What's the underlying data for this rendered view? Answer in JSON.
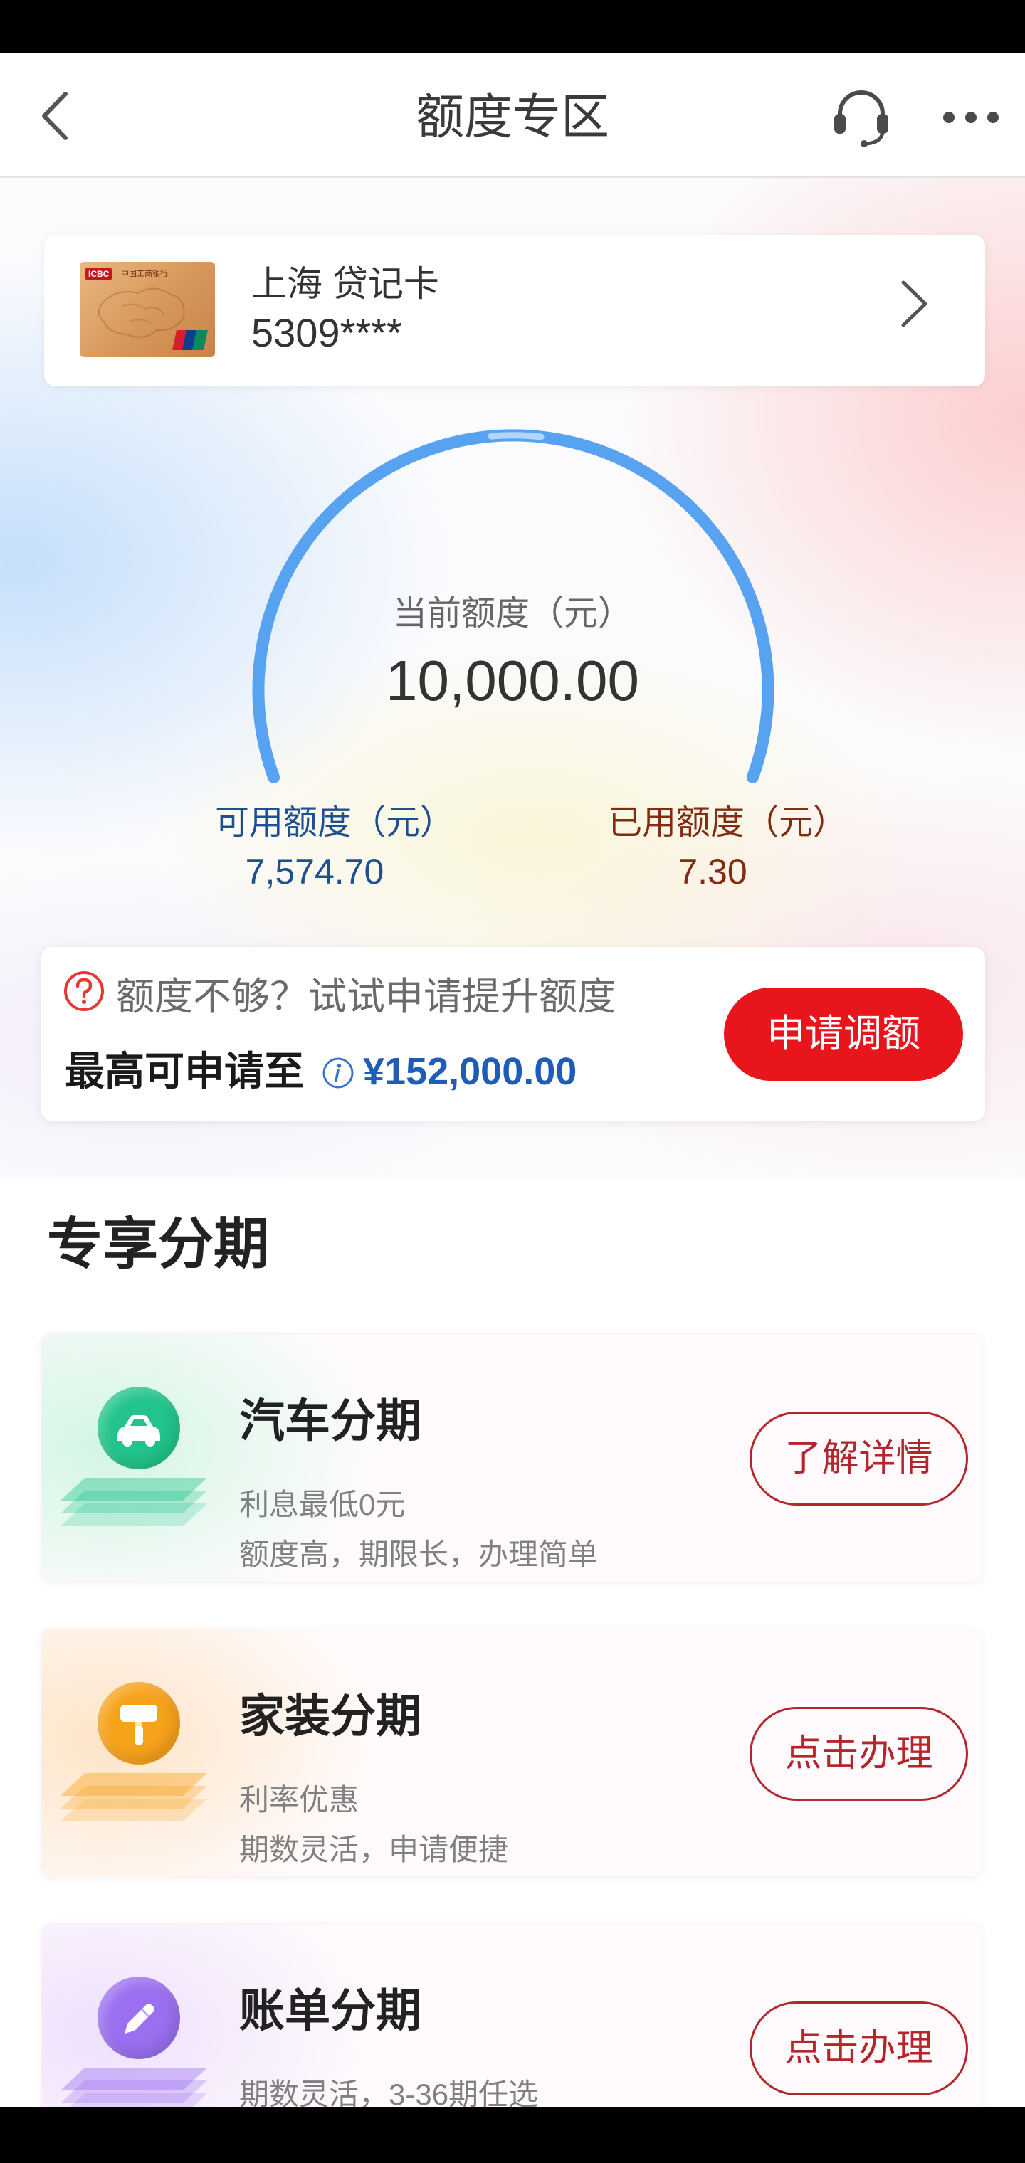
{
  "header": {
    "title": "额度专区",
    "back_icon": "chevron-left-icon",
    "service_icon": "headset-icon",
    "more_icon": "more-dots-icon"
  },
  "account": {
    "card_name": "上海 贷记卡",
    "card_number": "5309****",
    "card_image": {
      "bank_logo": "ICBC",
      "bank_name": "中国工商银行",
      "network_logo": "unionpay-logo"
    },
    "chevron_icon": "chevron-right-icon"
  },
  "quota": {
    "current_label": "当前额度（元）",
    "current_value": "10,000.00",
    "available_label": "可用额度（元）",
    "available_value": "7,574.70",
    "used_label": "已用额度（元）",
    "used_value": "7.30"
  },
  "increase": {
    "icon": "question-circle-icon",
    "prompt": "额度不够？试试申请提升额度",
    "max_label": "最高可申请至",
    "info_icon": "info-icon",
    "max_value": "¥152,000.00",
    "button": "申请调额"
  },
  "section_title": "专享分期",
  "products": [
    {
      "title": "汽车分期",
      "line1": "利息最低0元",
      "line2": "额度高，期限长，办理简单",
      "button": "了解详情",
      "icon": "car-icon",
      "accent": "#22c48c",
      "tint": "#d2f6e4"
    },
    {
      "title": "家装分期",
      "line1": "利率优惠",
      "line2": "期数灵活，申请便捷",
      "button": "点击办理",
      "icon": "paint-roller-icon",
      "accent": "#f7a21b",
      "tint": "#fde4c6"
    },
    {
      "title": "账单分期",
      "line1": "期数灵活，3-36期任选",
      "button": "点击办理",
      "icon": "pencil-icon",
      "accent": "#9a70f0",
      "tint": "#eee0fd"
    }
  ],
  "colors": {
    "gauge": "#58a2f2",
    "available_text": "#1d4f91",
    "used_text": "#842c12",
    "apply_button": "#e8161c",
    "limit_value": "#1f5cb8",
    "outline_button": "#b3262b",
    "question_icon": "#e53935"
  }
}
